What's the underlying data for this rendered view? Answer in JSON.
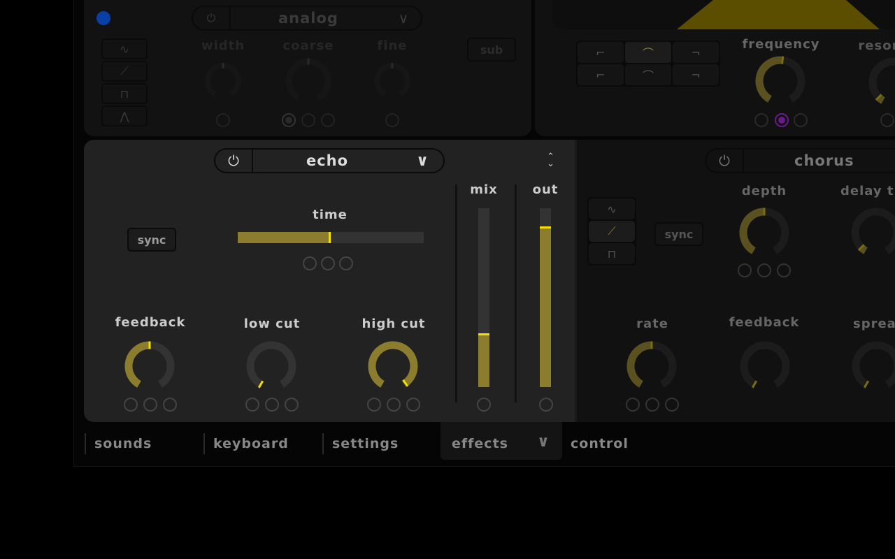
{
  "colors": {
    "accent": "#8c7d2e",
    "indicator": "#f2e000",
    "track": "#333333",
    "mod_active": "#8a2aa8",
    "osc_led": "#0a3fa8"
  },
  "oscillator": {
    "name": "analog",
    "sub_label": "sub",
    "knobs": [
      {
        "label": "width",
        "value": 0.5
      },
      {
        "label": "coarse",
        "value": 0.5
      },
      {
        "label": "fine",
        "value": 0.5
      }
    ],
    "waveforms": [
      "sine-icon",
      "saw-icon",
      "square-icon",
      "triangle-icon"
    ]
  },
  "filter": {
    "types": [
      "lowpass-icon",
      "bandpass-icon",
      "highpass-icon",
      "lowpass-2-icon",
      "bandpass-2-icon",
      "highpass-2-icon"
    ],
    "selected_type": 1,
    "knobs": [
      {
        "label": "frequency",
        "value": 0.52
      },
      {
        "label": "resona",
        "value": 0.05
      }
    ]
  },
  "echo": {
    "name": "echo",
    "enabled": true,
    "sync_label": "sync",
    "time": {
      "label": "time",
      "value": 0.5
    },
    "knobs": [
      {
        "label": "feedback",
        "value": 0.5
      },
      {
        "label": "low cut",
        "value": 0.0
      },
      {
        "label": "high cut",
        "value": 0.98
      }
    ],
    "mix": {
      "label": "mix",
      "value": 0.3
    },
    "out": {
      "label": "out",
      "value": 0.9
    }
  },
  "chorus": {
    "name": "chorus",
    "sync_label": "sync",
    "selected_wave": 1,
    "knobs": [
      {
        "label": "depth",
        "value": 0.5
      },
      {
        "label": "delay tir",
        "value": 0.05
      },
      {
        "label": "rate",
        "value": 0.5
      },
      {
        "label": "feedback",
        "value": 0.0
      },
      {
        "label": "spread",
        "value": 0.0
      }
    ]
  },
  "tabs": [
    {
      "label": "sounds"
    },
    {
      "label": "keyboard"
    },
    {
      "label": "settings"
    },
    {
      "label": "effects",
      "active": true
    },
    {
      "label": "control"
    }
  ]
}
